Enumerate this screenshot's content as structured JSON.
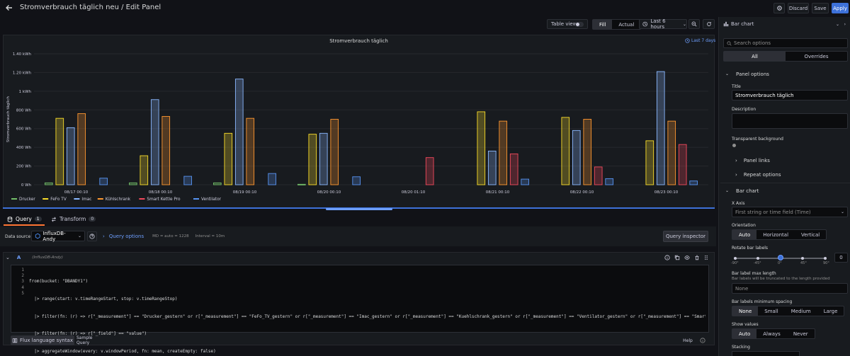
{
  "header": {
    "title": "Stromverbrauch täglich neu / Edit Panel",
    "discard": "Discard",
    "save": "Save",
    "apply": "Apply"
  },
  "toolbar": {
    "table_view": "Table view",
    "fill": "Fill",
    "actual": "Actual",
    "time_range": "Last 6 hours"
  },
  "panel": {
    "title": "Stromverbrauch täglich",
    "time_override": "Last 7 days"
  },
  "chart_data": {
    "type": "bar",
    "title": "Stromverbrauch täglich",
    "ylabel": "Stromverbrauch täglich",
    "ylim": [
      0,
      1400
    ],
    "y_ticks": [
      "0 Wh",
      "200 Wh",
      "400 Wh",
      "600 Wh",
      "800 Wh",
      "1 kWh",
      "1.20 kWh",
      "1.40 kWh"
    ],
    "categories": [
      "08/17 00:10",
      "08/18 00:10",
      "08/19 00:10",
      "08/20 00:10",
      "08/20 01:10",
      "08/21 00:10",
      "08/22 00:10",
      "08/23 00:10"
    ],
    "legend_placement": "bottom-left",
    "series": [
      {
        "name": "Drucker",
        "color": "#73bf69",
        "values": [
          20,
          20,
          20,
          5,
          0,
          0,
          0,
          0
        ]
      },
      {
        "name": "FeFo TV",
        "color": "#fade2a",
        "values": [
          710,
          310,
          550,
          540,
          0,
          780,
          720,
          470
        ]
      },
      {
        "name": "Imac",
        "color": "#8ab8ff",
        "values": [
          610,
          910,
          1130,
          550,
          0,
          360,
          580,
          1210
        ]
      },
      {
        "name": "Kühlschrank",
        "color": "#ff9830",
        "values": [
          760,
          730,
          710,
          700,
          0,
          680,
          700,
          680
        ]
      },
      {
        "name": "Smart Kettle Pro",
        "color": "#f2495c",
        "values": [
          0,
          0,
          0,
          0,
          290,
          330,
          190,
          430
        ]
      },
      {
        "name": "Ventilator",
        "color": "#5794f2",
        "values": [
          70,
          90,
          120,
          85,
          0,
          60,
          65,
          40
        ]
      }
    ]
  },
  "query_tabs": {
    "query_label": "Query",
    "query_count": "1",
    "transform_label": "Transform",
    "transform_count": "0"
  },
  "query_bar": {
    "data_source_label": "Data source",
    "data_source": "InfluxDB-Andy",
    "query_options": "Query options",
    "md": "MD = auto = 1228",
    "interval": "Interval = 10m",
    "query_inspector": "Query inspector"
  },
  "query": {
    "letter": "A",
    "source": "(InfluxDB-Andy)",
    "lines": [
      "from(bucket: \"DBANDY1\")",
      "  |> range(start: v.timeRangeStart, stop: v.timeRangeStop)",
      "  |> filter(fn: (r) => r[\"_measurement\"] == \"Drucker_gestern\" or r[\"_measurement\"] == \"FeFo_TV_gestern\" or r[\"_measurement\"] == \"Imac_gestern\" or r[\"_measurement\"] == \"Kuehlschrank_gestern\" or r[\"_measurement\"] == \"Ventilator_gestern\" or r[\"_measurement\"] == \"Smart_Kettle_Pro\")",
      "  |> filter(fn: (r) => r[\"_field\"] == \"value\")",
      "  |> aggregateWindow(every: v.windowPeriod, fn: mean, createEmpty: false)"
    ],
    "line_numbers": [
      "1",
      "2",
      "3",
      "4",
      "5"
    ],
    "flux_syntax": "Flux language syntax",
    "sample_query": "Sample Query",
    "help": "Help"
  },
  "options": {
    "viz": "Bar chart",
    "search_placeholder": "Search options",
    "tab_all": "All",
    "tab_overrides": "Overrides",
    "panel_options": "Panel options",
    "title_label": "Title",
    "title_value": "Stromverbrauch täglich",
    "description_label": "Description",
    "transparent_label": "Transparent background",
    "panel_links": "Panel links",
    "repeat_options": "Repeat options",
    "bar_chart_section": "Bar chart",
    "x_axis_label": "X Axis",
    "x_axis_placeholder": "First string or time field (Time)",
    "orientation_label": "Orientation",
    "orientation": [
      "Auto",
      "Horizontal",
      "Vertical"
    ],
    "rotate_label": "Rotate bar labels",
    "rotate_ticks": [
      "-90°",
      "-45°",
      "0°",
      "45°",
      "90°"
    ],
    "rotate_value": "0",
    "max_length_label": "Bar label max length",
    "max_length_desc": "Bar labels will be truncated to the length provided",
    "max_length_placeholder": "None",
    "min_spacing_label": "Bar labels minimum spacing",
    "min_spacing": [
      "None",
      "Small",
      "Medium",
      "Large"
    ],
    "show_values_label": "Show values",
    "show_values": [
      "Auto",
      "Always",
      "Never"
    ],
    "stacking_label": "Stacking"
  }
}
